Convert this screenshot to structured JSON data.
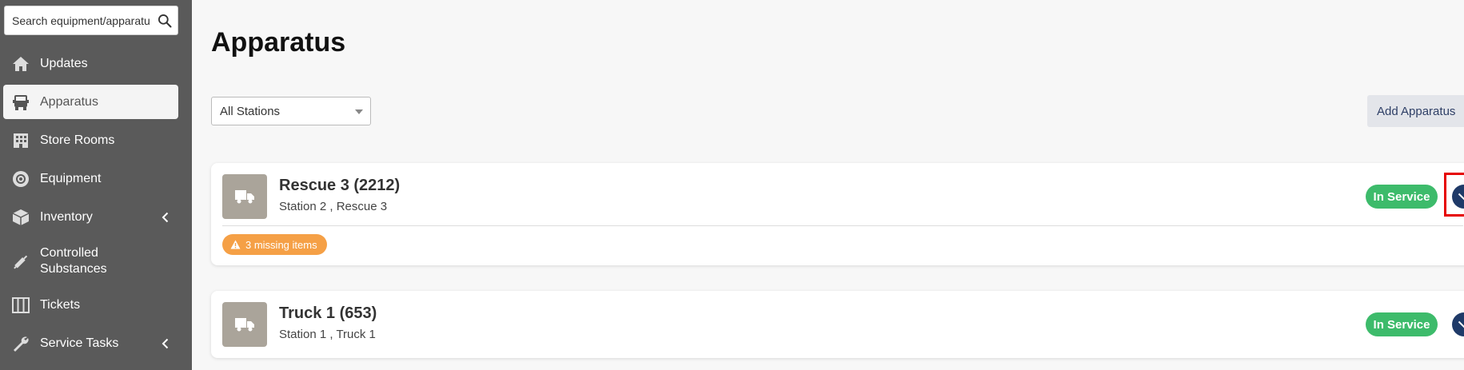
{
  "search": {
    "placeholder": "Search equipment/apparatus"
  },
  "sidebar": {
    "items": [
      {
        "label": "Updates",
        "icon": "home-icon"
      },
      {
        "label": "Apparatus",
        "icon": "truck-icon",
        "active": true
      },
      {
        "label": "Store Rooms",
        "icon": "building-icon"
      },
      {
        "label": "Equipment",
        "icon": "gear-icon"
      },
      {
        "label": "Inventory",
        "icon": "box-icon",
        "chevron": true
      },
      {
        "label": "Controlled Substances",
        "icon": "syringe-icon"
      },
      {
        "label": "Tickets",
        "icon": "columns-icon"
      },
      {
        "label": "Service Tasks",
        "icon": "wrench-icon",
        "chevron": true
      }
    ]
  },
  "main": {
    "title": "Apparatus",
    "station_filter": "All Stations",
    "add_button": "Add Apparatus",
    "apparatus": [
      {
        "name": "Rescue 3 (2212)",
        "subtitle": "Station 2 , Rescue 3",
        "status": "In Service",
        "alert": "3 missing items"
      },
      {
        "name": "Truck 1 (653)",
        "subtitle": "Station 1 , Truck 1",
        "status": "In Service"
      }
    ]
  },
  "colors": {
    "sidebar_bg": "#5a5a5a",
    "status_green": "#3dbb6b",
    "expand_navy": "#1f3a68",
    "alert_orange": "#f5a046",
    "highlight_red": "#e60000"
  }
}
